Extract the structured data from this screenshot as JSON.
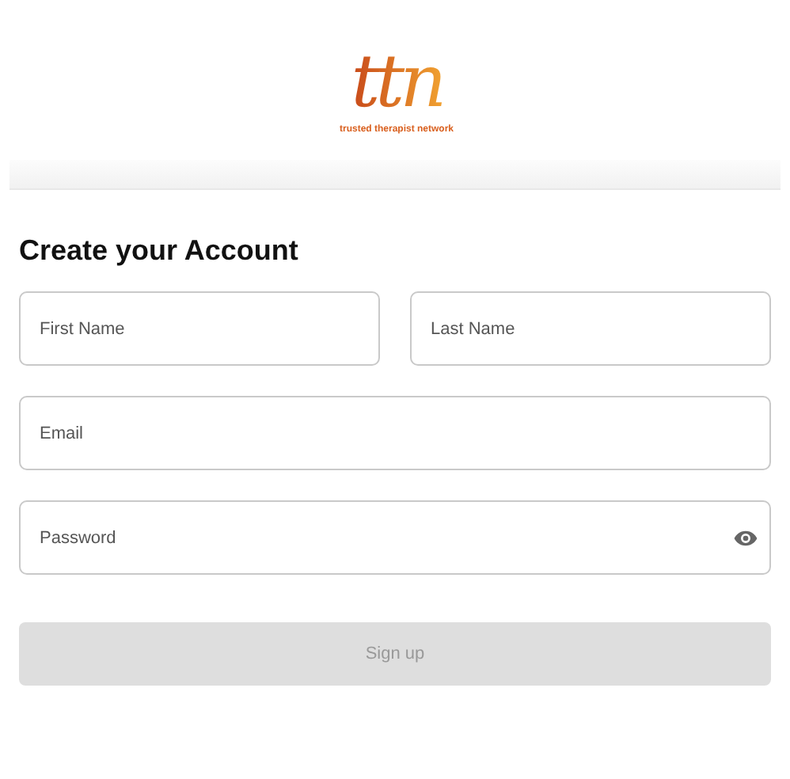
{
  "logo": {
    "mark": "ttn",
    "tagline": "trusted therapist network"
  },
  "heading": "Create your Account",
  "fields": [
    {
      "placeholder": "First Name",
      "kind": "text"
    },
    {
      "placeholder": "Last Name",
      "kind": "text"
    },
    {
      "placeholder": "Email",
      "kind": "text"
    },
    {
      "placeholder": "Password",
      "kind": "password"
    }
  ],
  "submit": {
    "label": "Sign up",
    "disabled": true
  }
}
